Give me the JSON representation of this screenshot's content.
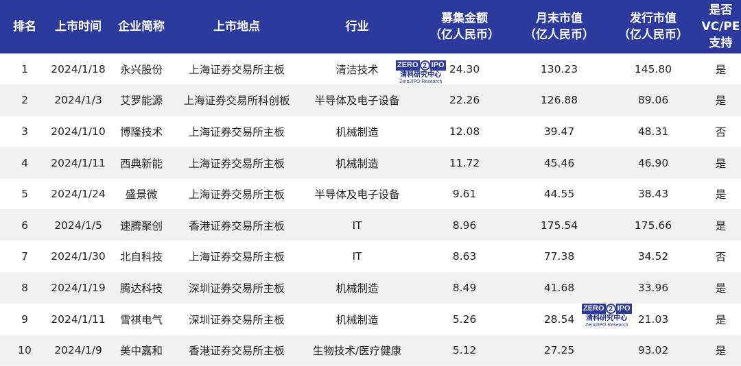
{
  "table": {
    "headers": [
      [
        "排名"
      ],
      [
        "上市时间"
      ],
      [
        "企业简称"
      ],
      [
        "上市地点"
      ],
      [
        "行业"
      ],
      [
        "募集金额",
        "（亿人民币）"
      ],
      [
        "月末市值",
        "（亿人民币）"
      ],
      [
        "发行市值",
        "（亿人民币）"
      ],
      [
        "是否",
        "VC/PE",
        "支持"
      ]
    ],
    "rows": [
      [
        "1",
        "2024/1/18",
        "永兴股份",
        "上海证券交易所主板",
        "清洁技术",
        "24.30",
        "130.23",
        "145.80",
        "是"
      ],
      [
        "2",
        "2024/1/3",
        "艾罗能源",
        "上海证券交易所科创板",
        "半导体及电子设备",
        "22.26",
        "126.88",
        "89.06",
        "是"
      ],
      [
        "3",
        "2024/1/10",
        "博隆技术",
        "上海证券交易所主板",
        "机械制造",
        "12.08",
        "39.47",
        "48.31",
        "否"
      ],
      [
        "4",
        "2024/1/11",
        "西典新能",
        "上海证券交易所主板",
        "机械制造",
        "11.72",
        "45.46",
        "46.90",
        "是"
      ],
      [
        "5",
        "2024/1/24",
        "盛景微",
        "上海证券交易所主板",
        "半导体及电子设备",
        "9.61",
        "44.55",
        "38.43",
        "是"
      ],
      [
        "6",
        "2024/1/5",
        "速腾聚创",
        "香港证券交易所主板",
        "IT",
        "8.96",
        "175.54",
        "175.66",
        "是"
      ],
      [
        "7",
        "2024/1/30",
        "北自科技",
        "上海证券交易所主板",
        "IT",
        "8.63",
        "77.38",
        "34.52",
        "否"
      ],
      [
        "8",
        "2024/1/19",
        "腾达科技",
        "深圳证券交易所主板",
        "机械制造",
        "8.49",
        "41.68",
        "33.96",
        "是"
      ],
      [
        "9",
        "2024/1/11",
        "雪祺电气",
        "深圳证券交易所主板",
        "机械制造",
        "5.26",
        "28.54",
        "21.03",
        "是"
      ],
      [
        "10",
        "2024/1/9",
        "美中嘉和",
        "香港证券交易所主板",
        "生物技术/医疗健康",
        "5.12",
        "27.25",
        "93.02",
        "是"
      ]
    ]
  },
  "watermark": {
    "zero": "ZERO",
    "two": "2",
    "ipo": "IPO",
    "cn": "清科研究中心",
    "en": "Zero2IPO Research"
  },
  "colors": {
    "header_bg": "#2b3a9c",
    "header_text": "#ffffff",
    "row_alt_bg": "#f1f1f1"
  }
}
